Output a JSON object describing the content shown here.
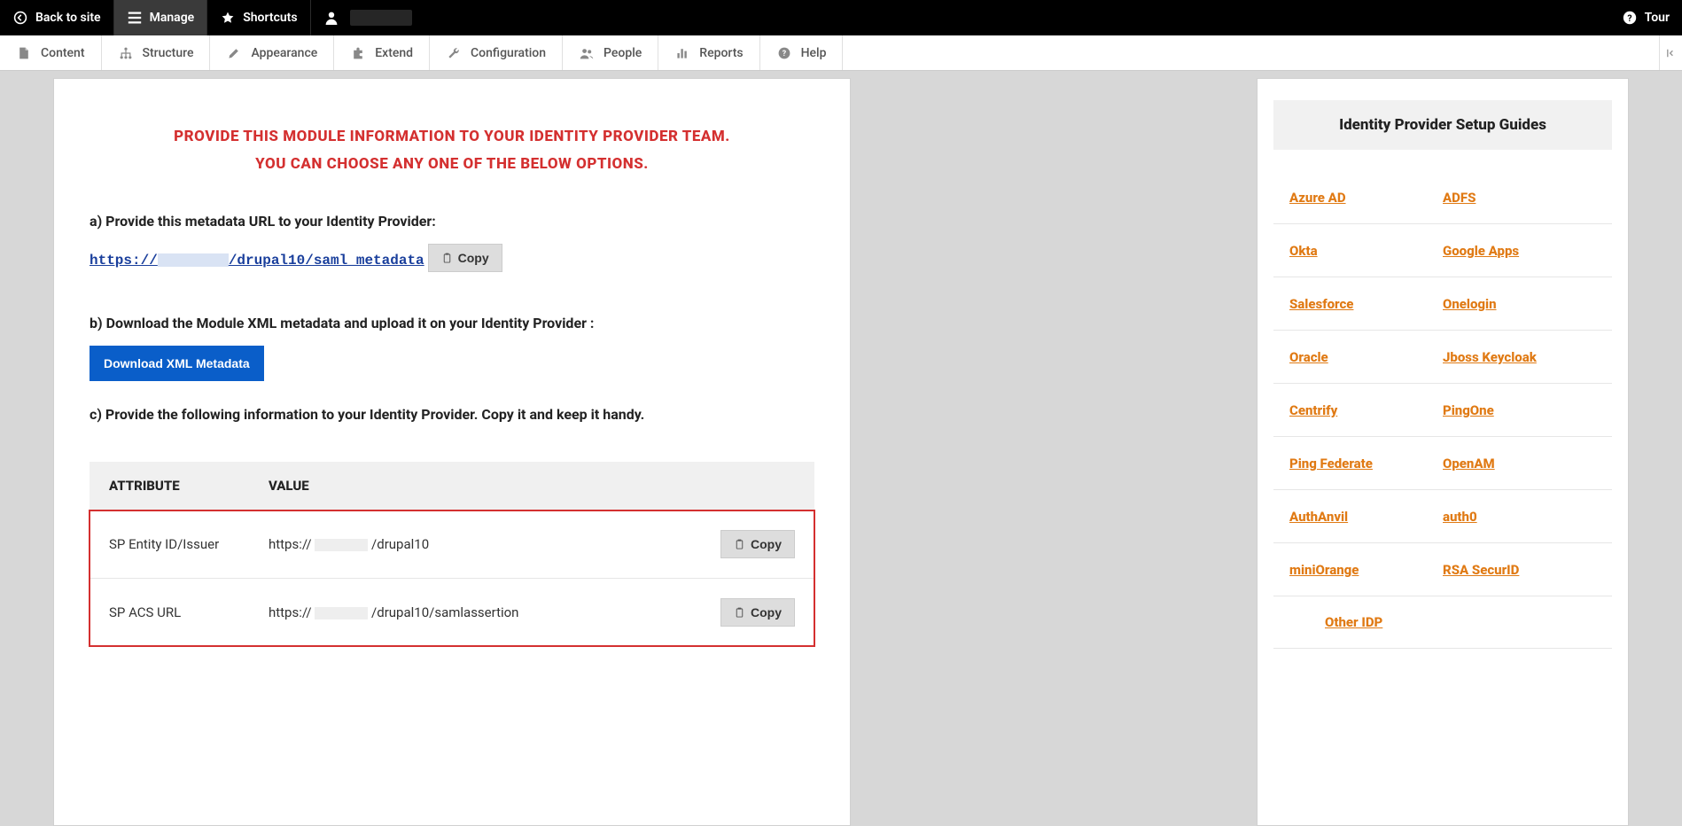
{
  "toolbar": {
    "back": "Back to site",
    "manage": "Manage",
    "shortcuts": "Shortcuts",
    "tour": "Tour"
  },
  "admin_menu": [
    "Content",
    "Structure",
    "Appearance",
    "Extend",
    "Configuration",
    "People",
    "Reports",
    "Help"
  ],
  "main": {
    "heading_line1": "PROVIDE THIS MODULE INFORMATION TO YOUR IDENTITY PROVIDER TEAM.",
    "heading_line2": "YOU CAN CHOOSE ANY ONE OF THE BELOW OPTIONS.",
    "step_a": "a) Provide this metadata URL to your Identity Provider:",
    "metadata_url_prefix": "https://",
    "metadata_url_suffix": "/drupal10/saml_metadata",
    "copy_label": "Copy",
    "step_b": "b) Download the Module XML metadata and upload it on your Identity Provider :",
    "download_label": "Download XML Metadata",
    "step_c": "c) Provide the following information to your Identity Provider. Copy it and keep it handy.",
    "table": {
      "header_attr": "ATTRIBUTE",
      "header_val": "VALUE",
      "rows": [
        {
          "attr": "SP Entity ID/Issuer",
          "val_prefix": "https://",
          "val_suffix": "/drupal10"
        },
        {
          "attr": "SP ACS URL",
          "val_prefix": "https://",
          "val_suffix": "/drupal10/samlassertion"
        }
      ]
    }
  },
  "sidebar": {
    "title": "Identity Provider Setup Guides",
    "guides": [
      [
        "Azure AD",
        "ADFS"
      ],
      [
        "Okta",
        "Google Apps"
      ],
      [
        "Salesforce",
        "Onelogin"
      ],
      [
        "Oracle",
        "Jboss Keycloak"
      ],
      [
        "Centrify",
        "PingOne"
      ],
      [
        "Ping Federate",
        "OpenAM"
      ],
      [
        "AuthAnvil",
        "auth0"
      ],
      [
        "miniOrange",
        "RSA SecurID"
      ]
    ],
    "other": "Other IDP"
  }
}
